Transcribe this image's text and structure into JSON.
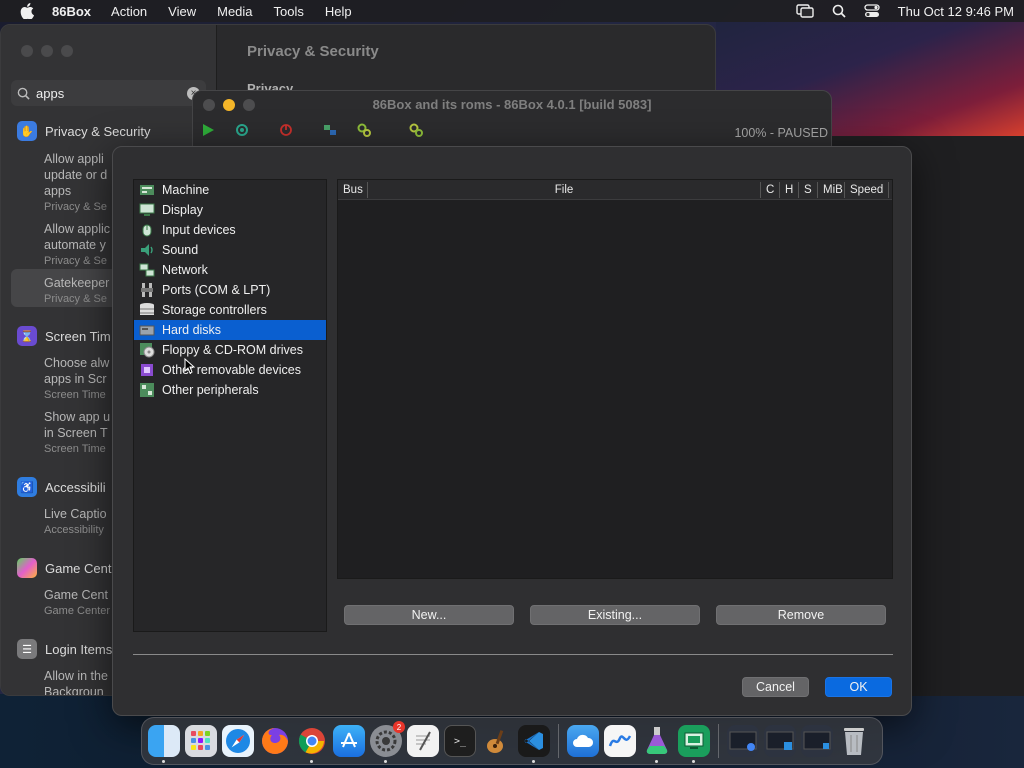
{
  "menubar": {
    "app_name": "86Box",
    "items": [
      "Action",
      "View",
      "Media",
      "Tools",
      "Help"
    ],
    "clock": "Thu Oct 12  9:46 PM"
  },
  "settings_window": {
    "search_value": "apps",
    "title": "Privacy & Security",
    "privacy_label": "Privacy",
    "sidebar": {
      "privacy_section": "Privacy & Security",
      "item1_line1": "Allow appli",
      "item1_line2": "update or d",
      "item1_line3": "apps",
      "item1_sub": "Privacy & Se",
      "item2_line1": "Allow applic",
      "item2_line2": "automate y",
      "item2_sub": "Privacy & Se",
      "item3_line1": "Gatekeeper",
      "item3_sub": "Privacy & Se",
      "screentime_section": "Screen Tim",
      "st1_line1": "Choose alw",
      "st1_line2": "apps in Scr",
      "st1_sub": "Screen Time",
      "st2_line1": "Show app u",
      "st2_line2": "in Screen T",
      "st2_sub": "Screen Time",
      "access_section": "Accessibili",
      "ac1_line1": "Live Captio",
      "ac1_sub": "Accessibility",
      "game_section": "Game Cent",
      "gc1_line1": "Game Cent",
      "gc1_sub": "Game Center",
      "login_section": "Login Items",
      "li1_line1": "Allow in the",
      "li1_line2": "Backgroun"
    }
  },
  "emulator_window": {
    "title": "86Box and its roms - 86Box 4.0.1 [build 5083]",
    "status": "100% - PAUSED"
  },
  "dialog": {
    "categories": [
      {
        "label": "Machine",
        "icon": "machine-icon"
      },
      {
        "label": "Display",
        "icon": "display-icon"
      },
      {
        "label": "Input devices",
        "icon": "input-icon"
      },
      {
        "label": "Sound",
        "icon": "sound-icon"
      },
      {
        "label": "Network",
        "icon": "network-icon"
      },
      {
        "label": "Ports (COM & LPT)",
        "icon": "ports-icon"
      },
      {
        "label": "Storage controllers",
        "icon": "storage-icon"
      },
      {
        "label": "Hard disks",
        "icon": "harddisk-icon"
      },
      {
        "label": "Floppy & CD-ROM drives",
        "icon": "floppy-icon"
      },
      {
        "label": "Other removable devices",
        "icon": "removable-icon"
      },
      {
        "label": "Other peripherals",
        "icon": "peripherals-icon"
      }
    ],
    "selected_index": 7,
    "table_headers": {
      "bus": "Bus",
      "file": "File",
      "c": "C",
      "h": "H",
      "s": "S",
      "mib": "MiB",
      "speed": "Speed"
    },
    "buttons": {
      "new": "New...",
      "existing": "Existing...",
      "remove": "Remove",
      "cancel": "Cancel",
      "ok": "OK"
    }
  },
  "dock": {
    "settings_badge": "2"
  }
}
